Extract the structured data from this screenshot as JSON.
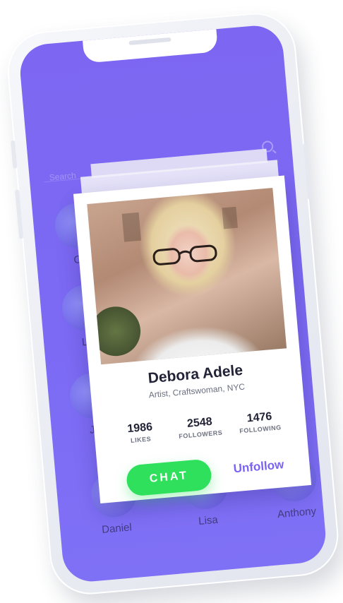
{
  "search": {
    "placeholder": "Search"
  },
  "contacts": [
    {
      "name": "Ch"
    },
    {
      "name": "Lu"
    },
    {
      "name": "Je"
    },
    {
      "name": "Daniel"
    },
    {
      "name": "Lisa"
    },
    {
      "name": "Anthony"
    }
  ],
  "profile": {
    "name": "Debora Adele",
    "subtitle": "Artist, Craftswoman, NYC",
    "stats": [
      {
        "value": "1986",
        "label": "LIKES"
      },
      {
        "value": "2548",
        "label": "FOLLOWERS"
      },
      {
        "value": "1476",
        "label": "FOLLOWING"
      }
    ],
    "chat_label": "CHAT",
    "unfollow_label": "Unfollow"
  },
  "colors": {
    "screen_bg": "#7d67f2",
    "chat_green": "#2fe05c",
    "accent_purple": "#7a63f2"
  }
}
